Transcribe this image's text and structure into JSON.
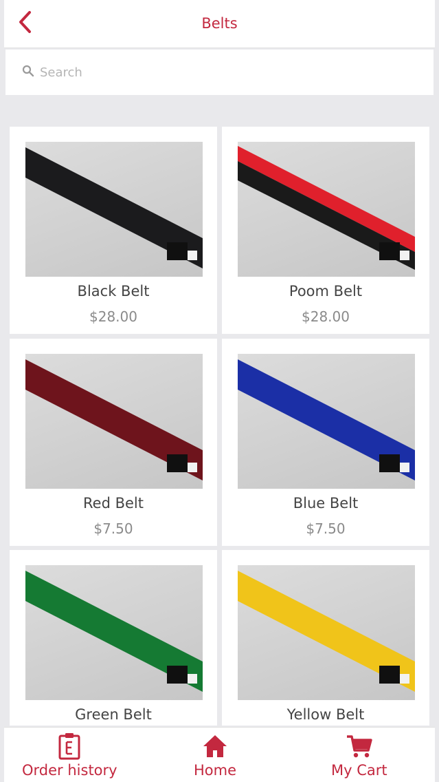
{
  "header": {
    "title": "Belts",
    "back_icon": "chevron-left-icon"
  },
  "search": {
    "placeholder": "Search",
    "value": "",
    "icon": "search-icon"
  },
  "products": [
    {
      "name": "Black Belt",
      "price": "$28.00",
      "colors": [
        "#1b1b1d"
      ]
    },
    {
      "name": "Poom Belt",
      "price": "$28.00",
      "colors": [
        "#e0202c",
        "#1a1a1a"
      ]
    },
    {
      "name": "Red Belt",
      "price": "$7.50",
      "colors": [
        "#6e141c"
      ]
    },
    {
      "name": "Blue Belt",
      "price": "$7.50",
      "colors": [
        "#1b2fa6"
      ]
    },
    {
      "name": "Green Belt",
      "price": "",
      "colors": [
        "#157a33"
      ]
    },
    {
      "name": "Yellow Belt",
      "price": "",
      "colors": [
        "#f0c41a"
      ]
    }
  ],
  "bottom_nav": [
    {
      "label": "Order history",
      "icon": "order-history-icon"
    },
    {
      "label": "Home",
      "icon": "home-icon"
    },
    {
      "label": "My Cart",
      "icon": "cart-icon"
    }
  ],
  "colors": {
    "accent": "#c3283f",
    "background": "#e9e9ec"
  }
}
